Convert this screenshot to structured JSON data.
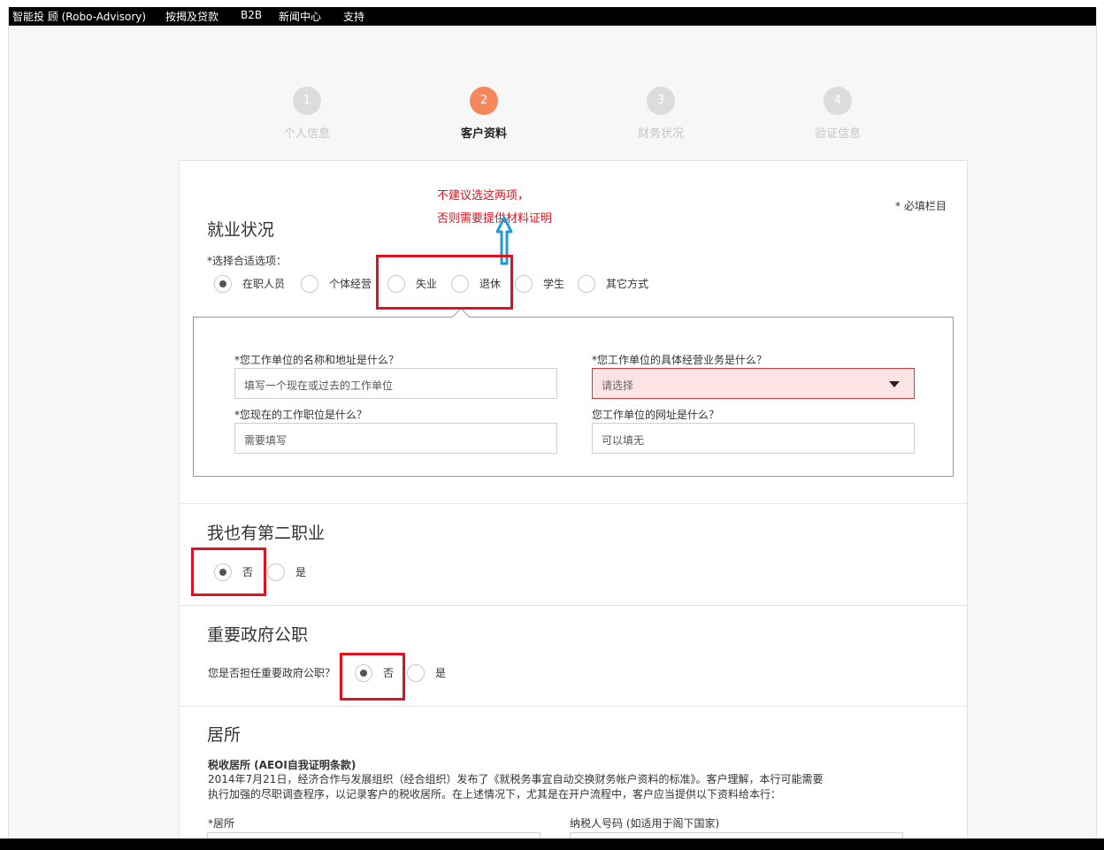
{
  "nav": {
    "items": [
      "智能投 顾 (Robo-Advisory)",
      "按揭及贷款",
      "B2B",
      "新闻中心",
      "支持"
    ]
  },
  "steps": [
    {
      "num": "1",
      "label": "个人信息"
    },
    {
      "num": "2",
      "label": "客户资料"
    },
    {
      "num": "3",
      "label": "财务状况"
    },
    {
      "num": "4",
      "label": "验证信息"
    }
  ],
  "active_step": 2,
  "required_note": "* 必填栏目",
  "annotation": {
    "line1": "不建议选这两项，",
    "line2": "否则需要提供材料证明"
  },
  "employment": {
    "title": "就业状况",
    "prompt": "*选择合适选项：",
    "options": [
      "在职人员",
      "个体经营",
      "失业",
      "退休",
      "学生",
      "其它方式"
    ],
    "selected": "在职人员",
    "fields": {
      "employer_label": "*您工作单位的名称和地址是什么？",
      "employer_placeholder": "填写一个现在或过去的工作单位",
      "business_label": "*您工作单位的具体经营业务是什么？",
      "business_value": "请选择",
      "position_label": "*您现在的工作职位是什么？",
      "position_placeholder": "需要填写",
      "website_label": "您工作单位的网址是什么？",
      "website_placeholder": "可以填无"
    }
  },
  "second_job": {
    "title": "我也有第二职业",
    "options": [
      "否",
      "是"
    ],
    "selected": "否"
  },
  "pep": {
    "title": "重要政府公职",
    "question": "您是否担任重要政府公职？",
    "options": [
      "否",
      "是"
    ],
    "selected": "否"
  },
  "residence": {
    "title": "居所",
    "subtitle": "税收居所 (AEOI自我证明条款)",
    "paragraph_line1": "2014年7月21日，经济合作与发展组织（经合组织）发布了《就税务事宜自动交换财务帐户资料的标准》。客户理解，本行可能需要",
    "paragraph_line2": "执行加强的尽职调查程序，以记录客户的税收居所。在上述情况下，尤其是在开户流程中，客户应当提供以下资料给本行：",
    "residence_label": "*居所",
    "tin_label": "纳税人号码 (如适用于阁下国家)"
  },
  "colors": {
    "accent": "#f4875c",
    "annotation_red": "#e1121f",
    "arrow_blue": "#1e9bd7",
    "error_fill": "#fde4e4"
  }
}
